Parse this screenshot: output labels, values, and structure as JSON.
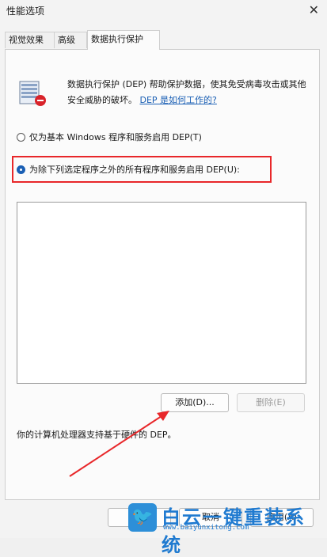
{
  "window": {
    "title": "性能选项",
    "close_glyph": "✕"
  },
  "tabs": [
    {
      "label": "视觉效果"
    },
    {
      "label": "高级"
    },
    {
      "label": "数据执行保护"
    }
  ],
  "dep": {
    "description": "数据执行保护 (DEP) 帮助保护数据，使其免受病毒攻击或其他安全威胁的破坏。",
    "link": "DEP 是如何工作的?",
    "option_essential": "仅为基本 Windows 程序和服务启用 DEP(T)",
    "option_all_except": "为除下列选定程序之外的所有程序和服务启用 DEP(U):",
    "add_button": "添加(D)...",
    "remove_button": "删除(E)",
    "hardware_support": "你的计算机处理器支持基于硬件的 DEP。"
  },
  "footer": {
    "ok_button": "",
    "cancel_button": "取消",
    "apply_button": "应用(A)"
  },
  "watermark": {
    "brand": "白云一键重装系统",
    "url": "www.baiyunxitong.com"
  },
  "colors": {
    "accent": "#1a5fb4",
    "highlight": "#e8272a"
  }
}
